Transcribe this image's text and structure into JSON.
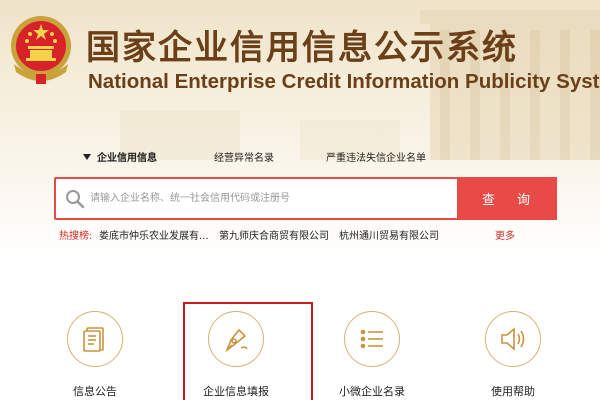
{
  "header": {
    "title_cn": "国家企业信用信息公示系统",
    "title_en": "National Enterprise Credit Information Publicity System",
    "emblem": "national-emblem"
  },
  "tabs": [
    {
      "label": "企业信用信息",
      "active": true
    },
    {
      "label": "经营异常名录",
      "active": false
    },
    {
      "label": "严重违法失信企业名单",
      "active": false
    }
  ],
  "search": {
    "placeholder": "请输入企业名称、统一社会信用代码或注册号",
    "value": "",
    "button_label": "查询",
    "icon": "search-icon"
  },
  "hot_search": {
    "label": "热搜榜:",
    "items": [
      "娄底市仲乐农业发展有...",
      "第九师庆合商贸有限公司",
      "杭州通川贸易有限公司"
    ],
    "more_label": "更多"
  },
  "services": [
    {
      "label": "信息公告",
      "icon": "document-icon"
    },
    {
      "label": "企业信息填报",
      "icon": "pen-icon"
    },
    {
      "label": "小微企业名录",
      "icon": "list-icon"
    },
    {
      "label": "使用帮助",
      "icon": "speaker-icon"
    }
  ],
  "colors": {
    "brand_brown": "#6b3f18",
    "accent_red": "#e84a45",
    "gold_ring": "#d9b173",
    "highlight_red": "#c41e1e"
  }
}
